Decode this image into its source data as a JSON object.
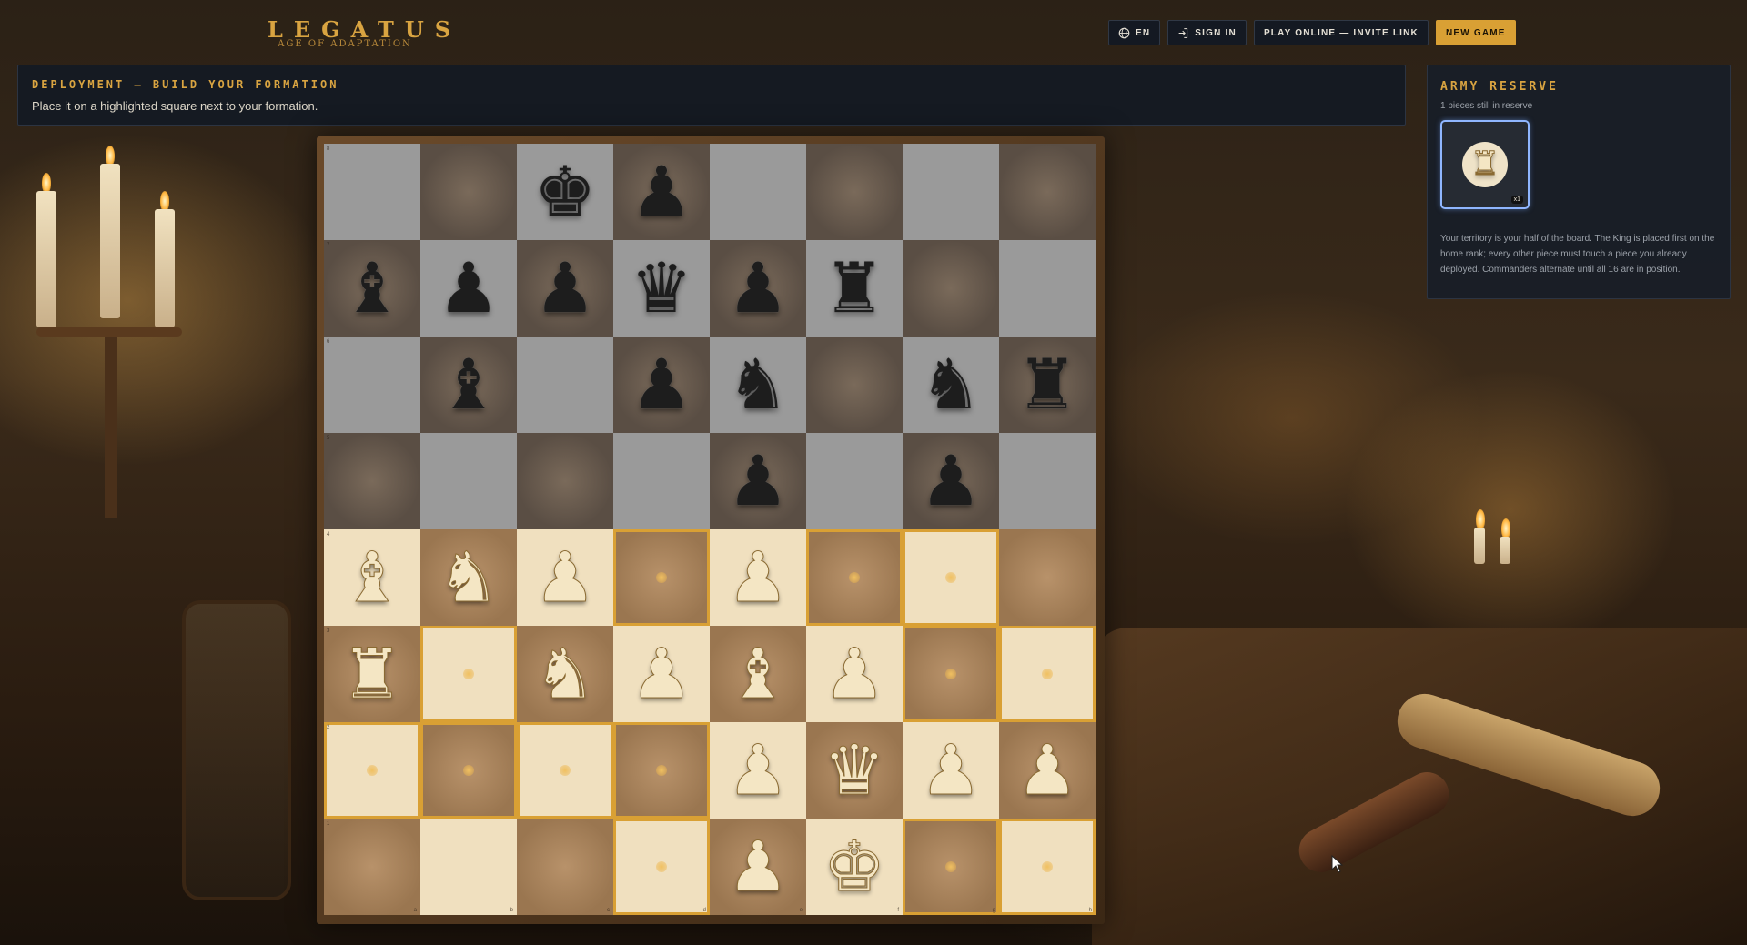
{
  "header": {
    "logo_title": "LEGATUS",
    "logo_subtitle": "AGE OF ADAPTATION",
    "lang_label": "EN",
    "signin_label": "SIGN IN",
    "play_online_label": "PLAY ONLINE — INVITE LINK",
    "new_game_label": "NEW GAME"
  },
  "banner": {
    "title": "DEPLOYMENT — BUILD YOUR FORMATION",
    "instruction": "Place it on a highlighted square next to your formation."
  },
  "reserve": {
    "title": "ARMY RESERVE",
    "count_text": "1 pieces still in reserve",
    "piece": "rook",
    "piece_glyph": "♜",
    "badge": "x1",
    "help_text": "Your territory is your half of the board. The King is placed first on the home rank; every other piece must touch a piece you already deployed. Commanders alternate until all 16 are in position."
  },
  "board": {
    "files": [
      "a",
      "b",
      "c",
      "d",
      "e",
      "f",
      "g",
      "h"
    ],
    "ranks": [
      "8",
      "7",
      "6",
      "5",
      "4",
      "3",
      "2",
      "1"
    ],
    "pieces": {
      "c8": "bK",
      "d8": "bP",
      "a7": "bB",
      "b7": "bP",
      "c7": "bP",
      "d7": "bQ",
      "e7": "bP",
      "f7": "bR",
      "b6": "bB",
      "d6": "bP",
      "e6": "bN",
      "g6": "bN",
      "h6": "bR",
      "e5": "bP",
      "g5": "bP",
      "a4": "wB",
      "b4": "wN",
      "c4": "wP",
      "e4": "wP",
      "a3": "wR",
      "c3": "wN",
      "d3": "wP",
      "e3": "wB",
      "f3": "wP",
      "e2": "wP",
      "f2": "wQ",
      "g2": "wP",
      "h2": "wP",
      "e1": "wP",
      "f1": "wK"
    },
    "highlighted": [
      "d4",
      "f4",
      "g4",
      "b3",
      "g3",
      "h3",
      "a2",
      "b2",
      "c2",
      "d2",
      "d1",
      "g1",
      "h1"
    ],
    "glyphs": {
      "K": "♚",
      "Q": "♛",
      "R": "♜",
      "B": "♝",
      "N": "♞",
      "P": "♟"
    }
  }
}
